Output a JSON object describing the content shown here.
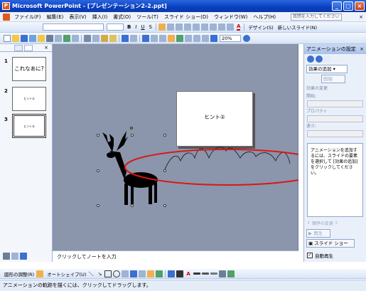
{
  "window": {
    "title": "Microsoft PowerPoint - [プレゼンテーション2-2.ppt]"
  },
  "menu": {
    "items": [
      "ファイル(F)",
      "編集(E)",
      "表示(V)",
      "挿入(I)",
      "書式(O)",
      "ツール(T)",
      "スライド ショー(D)",
      "ウィンドウ(W)",
      "ヘルプ(H)"
    ],
    "help_placeholder": "質問を入力してください"
  },
  "toolbar": {
    "zoom": "20%",
    "design_label": "デザイン(S)",
    "new_slide_label": "新しいスライド(N)"
  },
  "slides_pane": {
    "thumbnails": [
      {
        "number": "1",
        "text": "これなあに?"
      },
      {
        "number": "2",
        "text": "ヒント①"
      },
      {
        "number": "3",
        "text": "ヒント②"
      }
    ]
  },
  "slide": {
    "box_text": "ヒント②"
  },
  "notes": {
    "placeholder": "クリックしてノートを入力"
  },
  "task_pane": {
    "title": "アニメーションの設定",
    "add_effect": "効果の追加",
    "remove": "削除",
    "change_label": "効果の変更",
    "start_label": "開始:",
    "property_label": "プロパティ",
    "speed_label": "速さ:",
    "info_text": "アニメーションを追加するには、スライドの要素を選択して [効果の追加] をクリックしてください。",
    "reorder_label": "順序の変更",
    "play_label": "再生",
    "slideshow_label": "スライド ショー",
    "autopreview_label": "自動再生"
  },
  "draw_toolbar": {
    "draw_label": "図形の調整(R)",
    "autoshape_label": "オートシェイプ(U)"
  },
  "status": {
    "text": "アニメーションの軌跡を描くには、クリックしてドラッグします。"
  },
  "colors": {
    "titlebar": "#0a3fbf",
    "canvas": "#8b95ab",
    "highlight_ellipse": "#d81818",
    "taskpane": "#eaf0fa"
  }
}
